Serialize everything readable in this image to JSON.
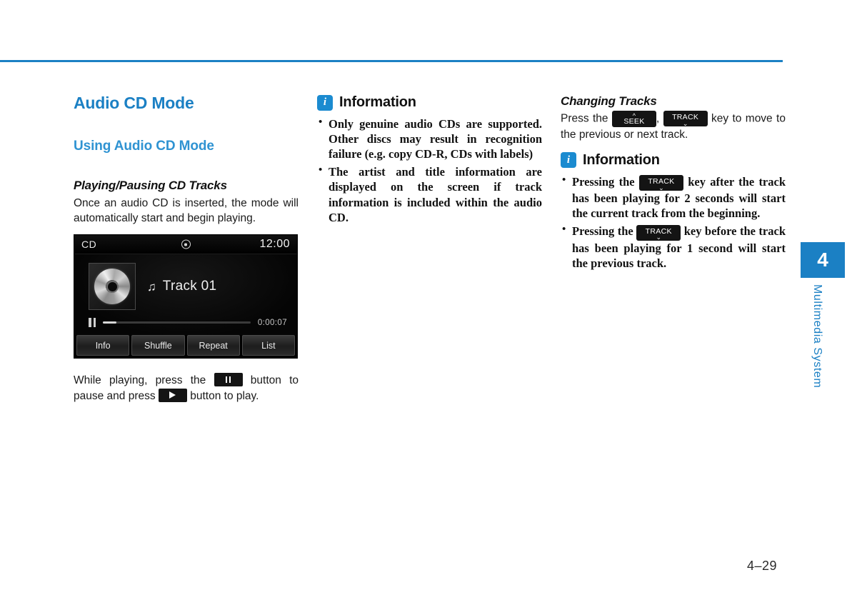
{
  "page": {
    "number": "4–29",
    "chapter_number": "4",
    "chapter_label": "Multimedia System",
    "accent_color": "#1b80c4"
  },
  "left_column": {
    "section_title": "Audio CD Mode",
    "subsection_title": "Using Audio CD Mode",
    "topic_title": "Playing/Pausing CD Tracks",
    "topic_body": "Once an audio CD is inserted, the mode will automatically start and begin playing.",
    "caption_part1": "While playing, press the",
    "caption_part2": "button to pause and press",
    "caption_part3": "button to play."
  },
  "head_unit": {
    "source_label": "CD",
    "disc_icon": "disc-icon",
    "clock": "12:00",
    "note_icon": "♫",
    "track_title": "Track 01",
    "elapsed_time": "0:00:07",
    "progress_percent": 9,
    "transport_state": "paused",
    "buttons": [
      {
        "label": "Info"
      },
      {
        "label": "Shuffle"
      },
      {
        "label": "Repeat"
      },
      {
        "label": "List"
      }
    ]
  },
  "middle_column": {
    "information": {
      "badge": "i",
      "title": "Information",
      "items": [
        "Only genuine audio CDs are supported. Other discs may result in recognition failure (e.g. copy CD-R, CDs with labels)",
        "The artist and title information are displayed on the screen if track information is included within the audio CD."
      ]
    }
  },
  "right_column": {
    "topic_title": "Changing Tracks",
    "changing_tracks": {
      "lead": "Press the",
      "comma": ",",
      "tail": "key to move to the previous or next track.",
      "seek_key": {
        "label": "SEEK",
        "chevron": "up"
      },
      "track_key": {
        "label": "TRACK",
        "chevron": "down"
      }
    },
    "information": {
      "badge": "i",
      "title": "Information",
      "items": [
        {
          "before": "Pressing the",
          "key": {
            "label": "TRACK",
            "chevron": "down"
          },
          "after": "key after the track has been playing for 2 seconds will start the current track from the beginning."
        },
        {
          "before": "Pressing the",
          "key": {
            "label": "TRACK",
            "chevron": "down"
          },
          "after": "key before the track has been playing for 1 second will start the previous track."
        }
      ]
    }
  }
}
